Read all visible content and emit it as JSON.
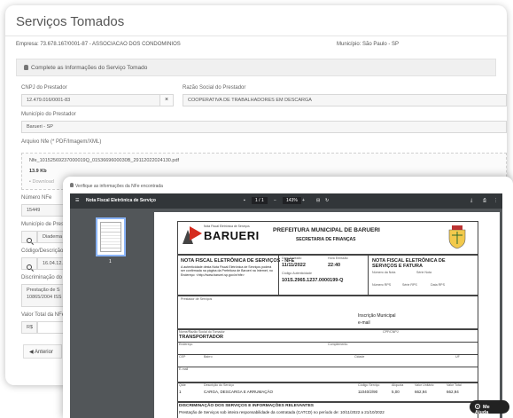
{
  "main": {
    "title": "Serviços Tomados",
    "empresa": "Empresa: 73.678.167/0001-87 - ASSOCIACAO DOS CONDOMINIOS",
    "municipio": "Município: São Paulo - SP",
    "panel_title": "Complete as Informações do Serviço Tomado",
    "cnpj_label": "CNPJ do Prestador",
    "cnpj_value": "12.479.016/0001-83",
    "razao_label": "Razão Social do Prestador",
    "razao_value": "COOPERATIVA DE TRABALHADORES EM DESCARGA",
    "municipio_prestador_label": "Município do Prestador",
    "municipio_prestador_value": "Barueri - SP",
    "arquivo_label": "Arquivo Nfe (* PDF/Imagem/XML)",
    "file_name": "Nfe_10152569237000019Q_0153669600030B_29112022024130.pdf",
    "file_size": "13.9 Kb",
    "download_label": "Download",
    "numero_label": "Número NFe",
    "numero_value": "15449",
    "municipio_prest_label": "Município de Prestação",
    "municipio_prest_value": "Diadema -",
    "codigo_label": "Código/Descrição",
    "codigo_value": "16.04.12.06",
    "discriminacao_label": "Discriminação do S",
    "discriminacao_value1": "Prestação de S",
    "discriminacao_value2": "10865/2004 ISS",
    "valor_label": "Valor Total da NFe",
    "valor_prefix": "R$",
    "anterior_button": "Anterior"
  },
  "pdf": {
    "window_title": "Verifique as informações da NFe encontrada",
    "doc_title": "Nota Fiscal Eletrônica de Serviço",
    "page_indicator": "1 / 1",
    "zoom": "143%",
    "thumb_number": "1",
    "logo_small": "Nota Fiscal Eletrônica de Serviços",
    "logo_big": "BARUERI",
    "prefeitura": "PREFEITURA MUNICIPAL DE BARUERI",
    "secretaria": "SECRETARIA DE FINANÇAS",
    "nota_title": "NOTA FISCAL ELETRÔNICA DE SERVIÇOS - NFE",
    "autenticidade": "A autenticidade desta Nota Fiscal Eletrônica de Serviços poderá ser confirmada na página da Prefeitura de Barueri na Internet, no Endereço: <http://www.barueri.sp.gov.br/nfe>",
    "data_emissao_label": "Data Emissão",
    "data_emissao": "11/11/2022",
    "hora_label": "Hora Emissão",
    "hora": "22:40",
    "codigo_aut_label": "Código Autenticidade",
    "codigo_aut": "101S.2965.1237.0000199-Q",
    "nfe_fatura": "NOTA FISCAL ELETRÔNICA DE SERVIÇOS E FATURA",
    "numero_nota_label": "Número da Nota",
    "serie_label": "Série Nota",
    "numero_rps_label": "Número RPS",
    "serie_rps_label": "Série RPS",
    "data_rps_label": "Data RPS",
    "prestador_label": "Prestador de Serviços",
    "inscricao": "Inscrição Municipal",
    "email": "e-mail",
    "tomador_label": "Nome/Razão Social do Tomador",
    "tomador": "TRANSPORTADOR",
    "cpf_label": "CPF/CNPJ",
    "endereco_label": "Endereço",
    "complemento_label": "Complemento",
    "cep_label": "CEP",
    "bairro_label": "Bairro",
    "cidade_label": "Cidade",
    "uf_label": "UF",
    "email_label": "E-mail",
    "qtde_label": "Qtde",
    "descricao_label": "Descrição do Serviço",
    "qtde": "1",
    "descricao": "CARGA, DESCARGA E ARRUMAÇÃO",
    "cod_servico_label": "Código Serviço",
    "cod_servico": "11040/2/90",
    "aliquota_label": "Alíquota",
    "aliquota": "5,00",
    "valor_unit_label": "Valor Unitário",
    "valor_unit": "662,94",
    "valor_total_label": "Valor Total",
    "valor_total": "662,94",
    "discriminacao_title": "DISCRIMINAÇÃO DOS SERVIÇOS E INFORMAÇÕES RELEVANTES",
    "discriminacao_text": "Prestação de Serviços sob inteira responsabilidade da contratada (CATCD) no período de: 10/11/2022 a 21/10/2022"
  },
  "help": {
    "label": "Me Ajuda"
  }
}
